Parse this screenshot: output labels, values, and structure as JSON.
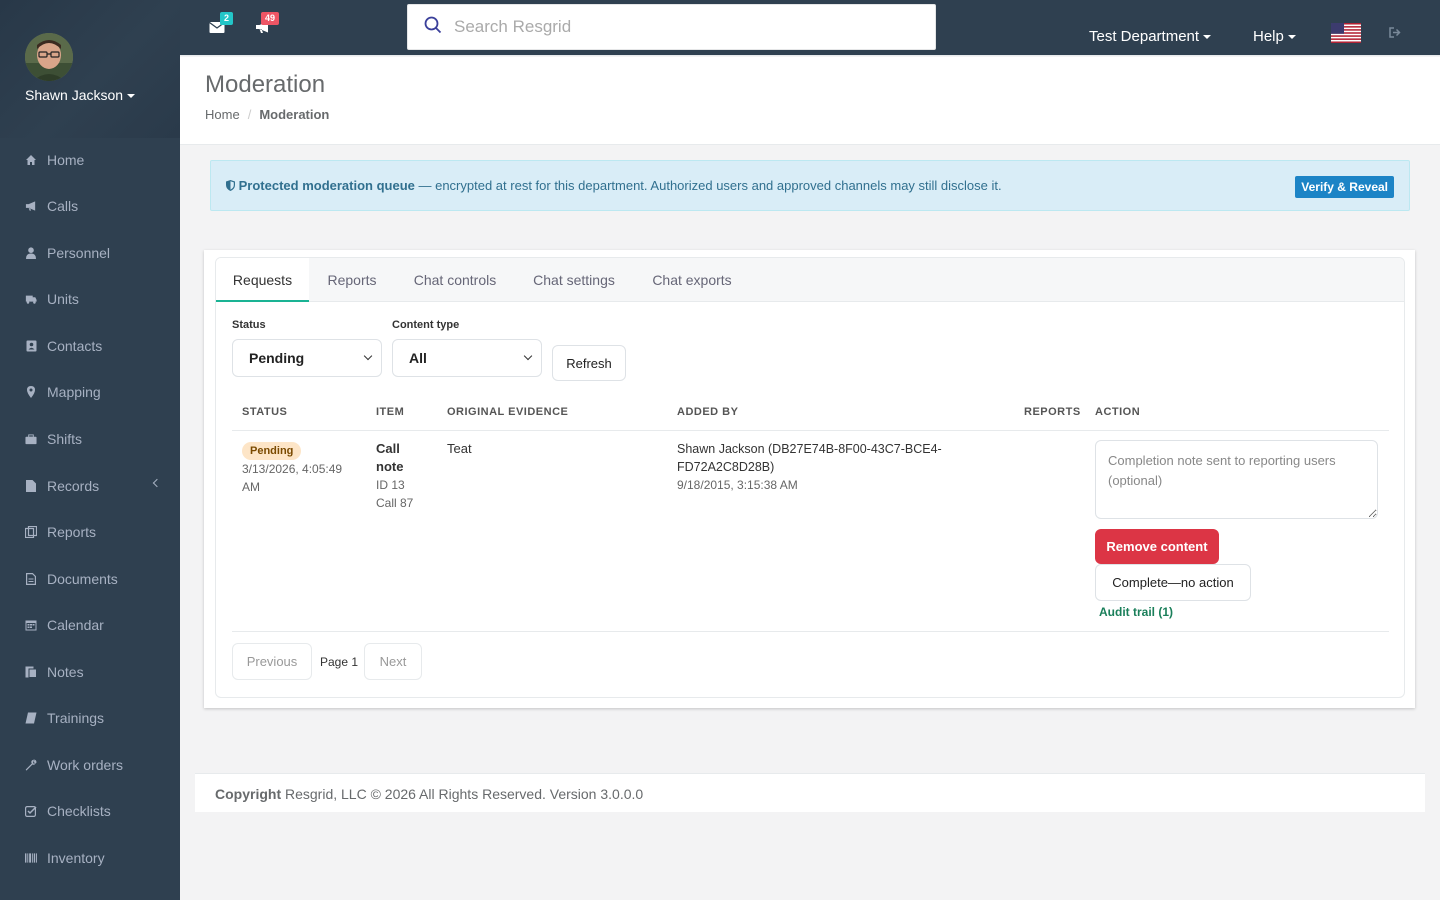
{
  "user": {
    "name": "Shawn Jackson"
  },
  "sidebar": {
    "items": [
      {
        "label": "Home",
        "icon": "home-icon"
      },
      {
        "label": "Calls",
        "icon": "bullhorn-icon"
      },
      {
        "label": "Personnel",
        "icon": "user-icon"
      },
      {
        "label": "Units",
        "icon": "truck-icon"
      },
      {
        "label": "Contacts",
        "icon": "address-book-icon"
      },
      {
        "label": "Mapping",
        "icon": "map-marker-icon"
      },
      {
        "label": "Shifts",
        "icon": "briefcase-icon"
      },
      {
        "label": "Records",
        "icon": "file-icon"
      },
      {
        "label": "Reports",
        "icon": "report-icon"
      },
      {
        "label": "Documents",
        "icon": "document-icon"
      },
      {
        "label": "Calendar",
        "icon": "calendar-icon"
      },
      {
        "label": "Notes",
        "icon": "notes-icon"
      },
      {
        "label": "Trainings",
        "icon": "book-icon"
      },
      {
        "label": "Work orders",
        "icon": "wrench-icon"
      },
      {
        "label": "Checklists",
        "icon": "checklist-icon"
      },
      {
        "label": "Inventory",
        "icon": "barcode-icon"
      }
    ]
  },
  "topbar": {
    "messages_count": "2",
    "calls_count": "49",
    "search_placeholder": "Search Resgrid",
    "department": "Test Department",
    "help": "Help"
  },
  "header": {
    "title": "Moderation",
    "breadcrumb_home": "Home",
    "breadcrumb_current": "Moderation"
  },
  "alert": {
    "title": "Protected moderation queue",
    "text": " — encrypted at rest for this department. Authorized users and approved channels may still disclose it.",
    "button": "Verify & Reveal"
  },
  "tabs": [
    {
      "label": "Requests"
    },
    {
      "label": "Reports"
    },
    {
      "label": "Chat controls"
    },
    {
      "label": "Chat settings"
    },
    {
      "label": "Chat exports"
    }
  ],
  "filters": {
    "status_label": "Status",
    "status_value": "Pending",
    "content_type_label": "Content type",
    "content_type_value": "All",
    "refresh": "Refresh"
  },
  "table": {
    "headers": {
      "status": "STATUS",
      "item": "ITEM",
      "evidence": "ORIGINAL EVIDENCE",
      "added_by": "ADDED BY",
      "reports": "REPORTS",
      "action": "ACTION"
    },
    "row": {
      "status": "Pending",
      "status_time_1": "3/13/2026, 4:05:49",
      "status_time_2": "AM",
      "item_title_1": "Call",
      "item_title_2": "note",
      "item_id": "ID 13",
      "item_call": "Call 87",
      "evidence": "Teat",
      "added_by_1": "Shawn Jackson (DB27E74B-8F00-43C7-BCE4-",
      "added_by_2": "FD72A2C8D28B)",
      "added_time": "9/18/2015, 3:15:38 AM",
      "note_placeholder": "Completion note sent to reporting users (optional)",
      "remove": "Remove content",
      "complete": "Complete—no action",
      "audit": "Audit trail (1)"
    }
  },
  "pager": {
    "previous": "Previous",
    "page": "Page 1",
    "next": "Next"
  },
  "footer": {
    "copyright": "Copyright",
    "text": " Resgrid, LLC © 2026 All Rights Reserved. Version 3.0.0.0"
  },
  "colors": {
    "sidebar_bg": "#2f4050",
    "accent": "#1ab394",
    "danger": "#dc3545",
    "info_btn": "#1c84c6",
    "badge_messages": "#23c6c8",
    "badge_calls": "#ed5565"
  }
}
